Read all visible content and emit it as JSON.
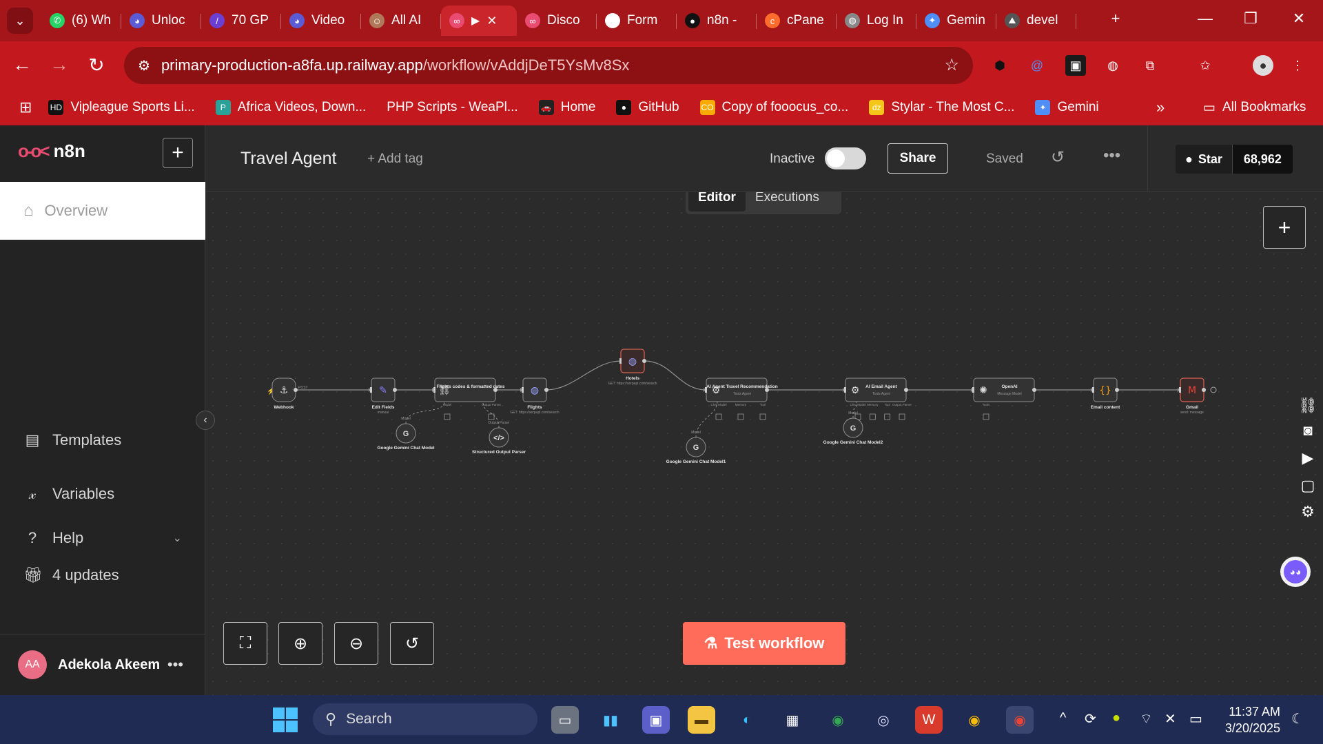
{
  "browser": {
    "tabs": [
      {
        "label": "(6) Wh",
        "icon": "whatsapp-icon",
        "color": "#25d366"
      },
      {
        "label": "Unloc",
        "icon": "bot-icon",
        "color": "#5b5bd6"
      },
      {
        "label": "70 GP",
        "icon": "pen-icon",
        "color": "#6b3fd1"
      },
      {
        "label": "Video",
        "icon": "bot-icon",
        "color": "#5b5bd6"
      },
      {
        "label": "All AI",
        "icon": "face-icon",
        "color": "#b07a5a"
      },
      {
        "label": "",
        "icon": "n8n-icon",
        "color": "#ea4b71",
        "active": true
      },
      {
        "label": "Disco",
        "icon": "n8n-icon",
        "color": "#ea4b71"
      },
      {
        "label": "Form",
        "icon": "asterisk-icon",
        "color": "#ffffff"
      },
      {
        "label": "n8n -",
        "icon": "github-icon",
        "color": "#111111"
      },
      {
        "label": "cPane",
        "icon": "cpanel-icon",
        "color": "#ff6c2c"
      },
      {
        "label": "Log In",
        "icon": "globe-icon",
        "color": "#888888"
      },
      {
        "label": "Gemin",
        "icon": "gemini-icon",
        "color": "#4f8df7"
      },
      {
        "label": "devel",
        "icon": "dev-icon",
        "color": "#555555"
      }
    ],
    "url_host": "primary-production-a8fa.up.railway.app",
    "url_path": "/workflow/vAddjDeT5YsMv8Sx",
    "bookmarks": [
      {
        "label": "Vipleague Sports Li...",
        "color": "#111111",
        "icon": "HD"
      },
      {
        "label": "Africa Videos, Down...",
        "color": "#2aa198",
        "icon": "P"
      },
      {
        "label": "PHP Scripts - WeaPl...",
        "color": "",
        "icon": ""
      },
      {
        "label": "Home",
        "color": "#222222",
        "icon": "🚗"
      },
      {
        "label": "GitHub",
        "color": "#111111",
        "icon": "●"
      },
      {
        "label": "Copy of fooocus_co...",
        "color": "#f9ab00",
        "icon": "CO"
      },
      {
        "label": "Stylar - The Most C...",
        "color": "#f5c518",
        "icon": "dz"
      },
      {
        "label": "Gemini",
        "color": "#4f8df7",
        "icon": "✦"
      }
    ],
    "all_bookmarks": "All Bookmarks"
  },
  "app": {
    "brand": "n8n",
    "sidebar": {
      "overview": "Overview",
      "templates": "Templates",
      "variables": "Variables",
      "help": "Help",
      "updates": "4 updates",
      "user_initials": "AA",
      "user_name": "Adekola Akeem"
    },
    "header": {
      "workflow_title": "Travel Agent",
      "add_tag": "+ Add tag",
      "status": "Inactive",
      "share": "Share",
      "saved": "Saved",
      "github_star": "Star",
      "github_count": "68,962"
    },
    "mode_tabs": {
      "editor": "Editor",
      "executions": "Executions"
    },
    "test_workflow": "Test workflow"
  },
  "workflow": {
    "nodes": [
      {
        "id": "webhook",
        "title": "Webhook",
        "subtitle": "",
        "tag": "POST",
        "icon": "webhook-icon"
      },
      {
        "id": "edit",
        "title": "Edit Fields",
        "subtitle": "manual",
        "icon": "pencil-icon"
      },
      {
        "id": "flightcodes",
        "title": "Flights codes & formatted dates",
        "subtitle": "",
        "icon": "link-icon",
        "ports": [
          "Model",
          "Output Parser"
        ]
      },
      {
        "id": "flights",
        "title": "Flights",
        "subtitle": "GET: https://serpapi.com/search",
        "icon": "globe-icon"
      },
      {
        "id": "hotels",
        "title": "Hotels",
        "subtitle": "GET: https://serpapi.com/search",
        "icon": "globe-icon"
      },
      {
        "id": "agent1",
        "title": "AI Agent Travel Recommendation",
        "subtitle": "Tools Agent",
        "icon": "robot-icon",
        "ports": [
          "Chat Model",
          "Memory",
          "Tool"
        ]
      },
      {
        "id": "agent2",
        "title": "AI Email Agent",
        "subtitle": "Tools Agent",
        "icon": "robot-icon",
        "ports": [
          "Chat Model",
          "Memory",
          "Tool",
          "Output Parser"
        ]
      },
      {
        "id": "openai",
        "title": "OpenAI",
        "subtitle": "Message Model",
        "icon": "openai-icon",
        "ports": [
          "Tools"
        ]
      },
      {
        "id": "email",
        "title": "Email content",
        "subtitle": "",
        "icon": "braces-icon"
      },
      {
        "id": "gmail",
        "title": "Gmail",
        "subtitle": "send: message",
        "icon": "gmail-icon"
      },
      {
        "id": "gemini0",
        "title": "Google Gemini Chat Model",
        "subtitle": "",
        "icon": "google-icon",
        "port_label": "Model"
      },
      {
        "id": "parser",
        "title": "Structured Output Parser",
        "subtitle": "",
        "icon": "code-icon",
        "port_label": "Output Parser"
      },
      {
        "id": "gemini1",
        "title": "Google Gemini Chat Model1",
        "subtitle": "",
        "icon": "google-icon",
        "port_label": "Model"
      },
      {
        "id": "gemini2",
        "title": "Google Gemini Chat Model2",
        "subtitle": "",
        "icon": "google-icon",
        "port_label": "Model"
      }
    ]
  },
  "taskbar": {
    "search": "Search",
    "time": "11:37 AM",
    "date": "3/20/2025"
  },
  "colors": {
    "brand": "#ea4b71",
    "test_button": "#ff6d5a",
    "chrome_red": "#c3191e",
    "node_border": "#8f8f8f"
  }
}
